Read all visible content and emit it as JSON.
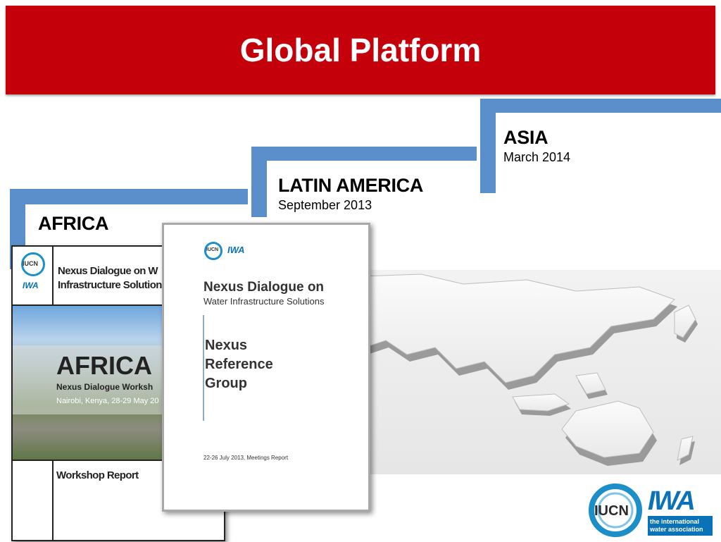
{
  "slide": {
    "title": "Global Platform"
  },
  "regions": [
    {
      "name": "AFRICA",
      "date": ""
    },
    {
      "name": "LATIN AMERICA",
      "date": "September 2013"
    },
    {
      "name": "ASIA",
      "date": "March 2014"
    }
  ],
  "africa_report": {
    "logo_iucn": "IUCN",
    "logo_iwa": "IWA",
    "heading_line1": "Nexus Dialogue on W",
    "heading_line2": "Infrastructure Solution",
    "banner": "AFRICA",
    "subtitle": "Nexus Dialogue Worksh",
    "location": "Nairobi, Kenya, 28-29 May 20",
    "footer": "Workshop Report"
  },
  "nexus_report": {
    "logo_iucn": "IUCN",
    "logo_iwa": "IWA",
    "title_line1": "Nexus Dialogue on",
    "title_line2": "Water Infrastructure Solutions",
    "group_line1": "Nexus",
    "group_line2": "Reference",
    "group_line3": "Group",
    "footer": "22-26 July 2013, Meetings Report"
  },
  "logos": {
    "iucn": "IUCN",
    "iwa": "IWA",
    "iwa_tagline_1": "the international",
    "iwa_tagline_2": "water association"
  },
  "colors": {
    "title_bar": "#c4000b",
    "tab_blue": "#5b8fcb",
    "iucn_blue": "#1c8ec8",
    "iwa_blue": "#0a72b8"
  }
}
